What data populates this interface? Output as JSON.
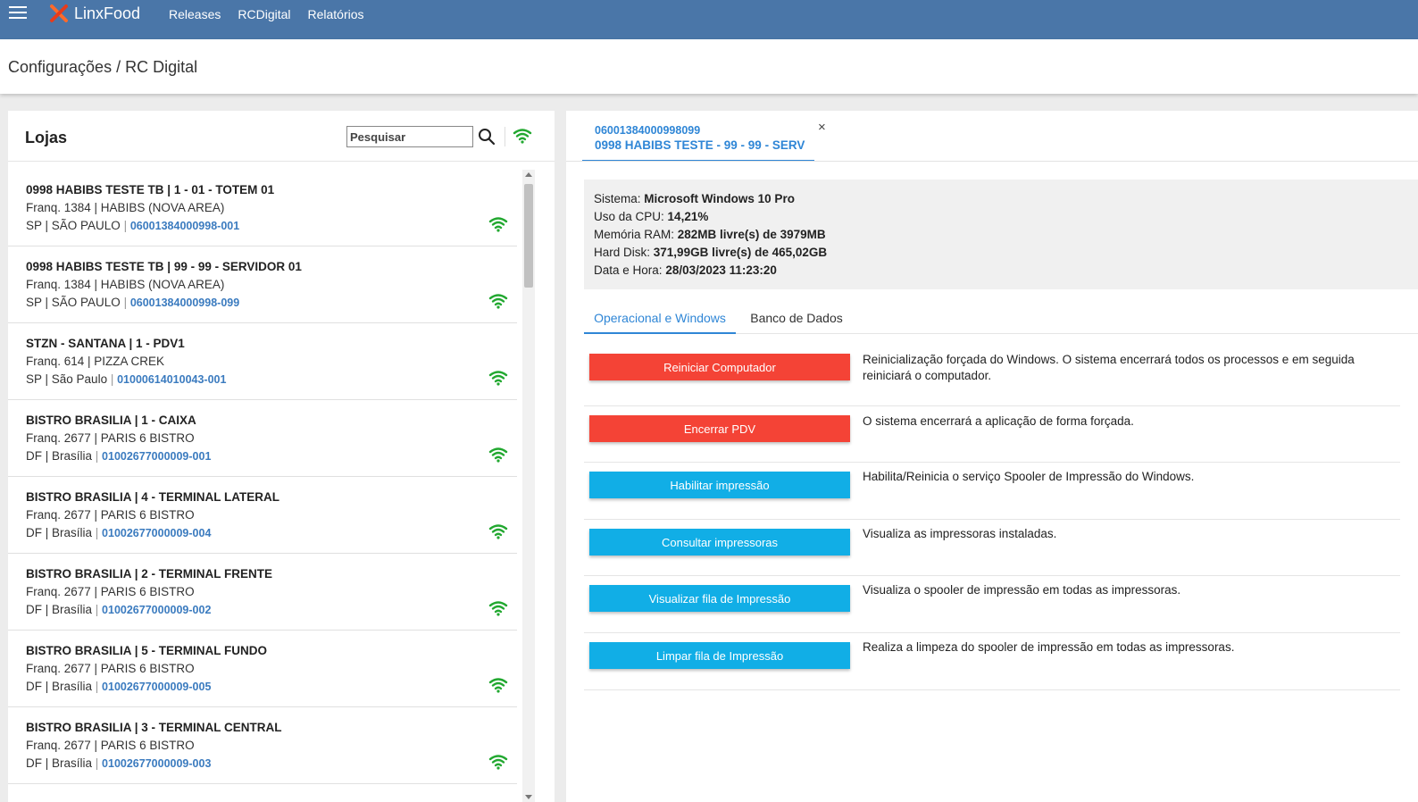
{
  "app": {
    "brand": "LinxFood",
    "nav": [
      "Releases",
      "RCDigital",
      "Relatórios"
    ],
    "page_title": "Configurações / RC Digital"
  },
  "left": {
    "title": "Lojas",
    "search_placeholder": "Pesquisar",
    "stores": [
      {
        "name": "0998 HABIBS TESTE TB | 1 - 01 - TOTEM 01",
        "franq": "Franq. 1384 | HABIBS (NOVA AREA)",
        "loc": "SP | SÃO PAULO",
        "code": "06001384000998-001"
      },
      {
        "name": "0998 HABIBS TESTE TB | 99 - 99 - SERVIDOR 01",
        "franq": "Franq. 1384 | HABIBS (NOVA AREA)",
        "loc": "SP | SÃO PAULO",
        "code": "06001384000998-099"
      },
      {
        "name": "STZN - SANTANA | 1 - PDV1",
        "franq": "Franq. 614 | PIZZA CREK",
        "loc": "SP | São Paulo",
        "code": "01000614010043-001"
      },
      {
        "name": "BISTRO BRASILIA | 1 - CAIXA",
        "franq": "Franq. 2677 | PARIS 6 BISTRO",
        "loc": "DF | Brasília",
        "code": "01002677000009-001"
      },
      {
        "name": "BISTRO BRASILIA | 4 - TERMINAL LATERAL",
        "franq": "Franq. 2677 | PARIS 6 BISTRO",
        "loc": "DF | Brasília",
        "code": "01002677000009-004"
      },
      {
        "name": "BISTRO BRASILIA | 2 - TERMINAL FRENTE",
        "franq": "Franq. 2677 | PARIS 6 BISTRO",
        "loc": "DF | Brasília",
        "code": "01002677000009-002"
      },
      {
        "name": "BISTRO BRASILIA | 5 - TERMINAL FUNDO",
        "franq": "Franq. 2677 | PARIS 6 BISTRO",
        "loc": "DF | Brasília",
        "code": "01002677000009-005"
      },
      {
        "name": "BISTRO BRASILIA | 3 - TERMINAL CENTRAL",
        "franq": "Franq. 2677 | PARIS 6 BISTRO",
        "loc": "DF | Brasília",
        "code": "01002677000009-003"
      }
    ]
  },
  "detail": {
    "tab_code": "06001384000998099",
    "tab_name": "0998 HABIBS TESTE - 99 - 99 - SERV",
    "close": "×",
    "sysinfo": [
      {
        "label": "Sistema:",
        "value": "Microsoft Windows 10 Pro"
      },
      {
        "label": "Uso da CPU:",
        "value": "14,21%"
      },
      {
        "label": "Memória RAM:",
        "value": "282MB livre(s) de 3979MB"
      },
      {
        "label": "Hard Disk:",
        "value": "371,99GB livre(s) de 465,02GB"
      },
      {
        "label": "Data e Hora:",
        "value": "28/03/2023 11:23:20"
      }
    ],
    "subtabs": [
      "Operacional e Windows",
      "Banco de Dados"
    ],
    "actions": [
      {
        "label": "Reiniciar Computador",
        "desc": "Reinicialização forçada do Windows. O sistema encerrará todos os processos e em seguida reiniciará o computador.",
        "color": "#f44336"
      },
      {
        "label": "Encerrar PDV",
        "desc": "O sistema encerrará a aplicação de forma forçada.",
        "color": "#f44336"
      },
      {
        "label": "Habilitar impressão",
        "desc": "Habilita/Reinicia o serviço Spooler de Impressão do Windows.",
        "color": "#11aee6"
      },
      {
        "label": "Consultar impressoras",
        "desc": "Visualiza as impressoras instaladas.",
        "color": "#11aee6"
      },
      {
        "label": "Visualizar fila de Impressão",
        "desc": "Visualiza o spooler de impressão em todas as impressoras.",
        "color": "#11aee6"
      },
      {
        "label": "Limpar fila de Impressão",
        "desc": "Realiza a limpeza do spooler de impressão em todas as impressoras.",
        "color": "#11aee6"
      }
    ]
  },
  "colors": {
    "topbar": "#4a76a8",
    "accent": "#2f86d6",
    "danger": "#f44336",
    "info": "#11aee6",
    "online": "#22a830"
  }
}
